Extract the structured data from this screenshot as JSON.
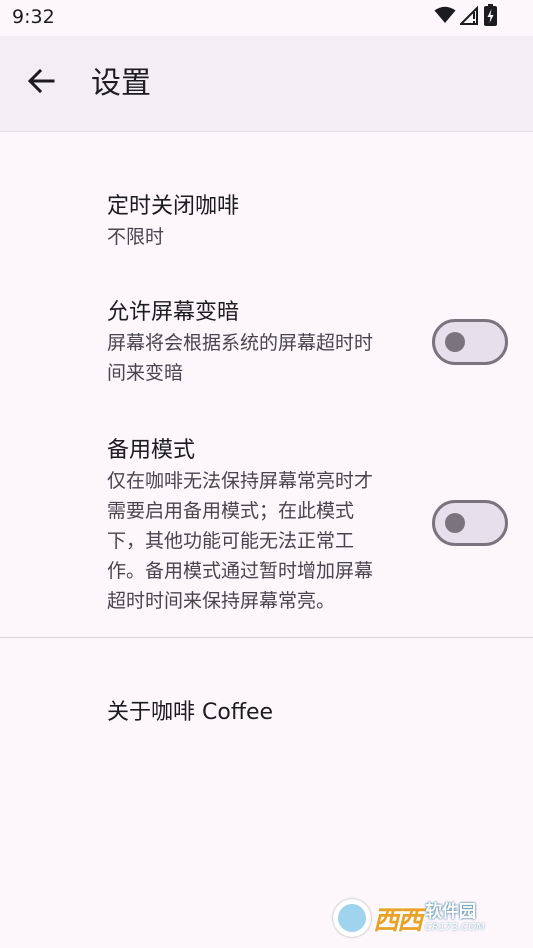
{
  "status_bar": {
    "time": "9:32",
    "icons": [
      "wifi-icon",
      "cellular-no-signal-icon",
      "battery-charging-icon"
    ]
  },
  "app_bar": {
    "title": "设置",
    "back_icon": "arrow-back-icon"
  },
  "preferences": [
    {
      "title": "定时关闭咖啡",
      "summary": [
        "不限时"
      ]
    },
    {
      "title": "允许屏幕变暗",
      "summary": [
        "屏幕将会根据系统的屏幕超时时",
        "间来变暗"
      ],
      "switch_on": false
    },
    {
      "title": "备用模式",
      "summary": [
        "仅在咖啡无法保持屏幕常亮时才",
        "需要启用备用模式；在此模式",
        "下，其他功能可能无法正常工",
        "作。备用模式通过暂时增加屏幕",
        "超时时间来保持屏幕常亮。"
      ],
      "switch_on": false
    },
    {
      "title": "关于咖啡 Coffee"
    }
  ],
  "watermark": {
    "brand": "西西",
    "cn": "软件园",
    "en": "CR173.COM"
  },
  "colors": {
    "background": "#fdf7fc",
    "app_bar": "#f3eef4",
    "switch_outline": "#79747e",
    "switch_track": "#e7e0ec"
  }
}
